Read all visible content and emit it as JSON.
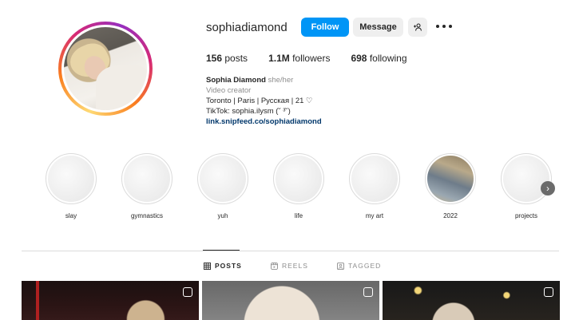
{
  "profile": {
    "username": "sophiadiamond",
    "follow_label": "Follow",
    "message_label": "Message",
    "stats": {
      "posts_count": "156",
      "posts_label": "posts",
      "followers_count": "1.1M",
      "followers_label": "followers",
      "following_count": "698",
      "following_label": "following"
    },
    "bio": {
      "name": "Sophia Diamond",
      "pronouns": "she/her",
      "category": "Video creator",
      "line1": "Toronto | Paris | Русская | 21 ♡",
      "line2": "TikTok: sophia.ilysm (˘ ³˘)",
      "link": "link.snipfeed.co/sophiadiamond"
    }
  },
  "highlights": [
    {
      "label": "slay"
    },
    {
      "label": "gymnastics"
    },
    {
      "label": "yuh"
    },
    {
      "label": "life"
    },
    {
      "label": "my art"
    },
    {
      "label": "2022"
    },
    {
      "label": "projects"
    }
  ],
  "tabs": [
    {
      "label": "POSTS",
      "active": true
    },
    {
      "label": "REELS",
      "active": false
    },
    {
      "label": "TAGGED",
      "active": false
    }
  ],
  "colors": {
    "follow_button": "#0095f6",
    "link": "#00376b",
    "secondary_text": "#8e8e8e"
  },
  "icons": {
    "add_user": "person-plus-icon",
    "more": "more-options-icon",
    "next": "chevron-right-icon",
    "posts_tab": "grid-icon",
    "reels_tab": "reels-icon",
    "tagged_tab": "tagged-icon",
    "post_badge": "multiple-posts-icon"
  }
}
